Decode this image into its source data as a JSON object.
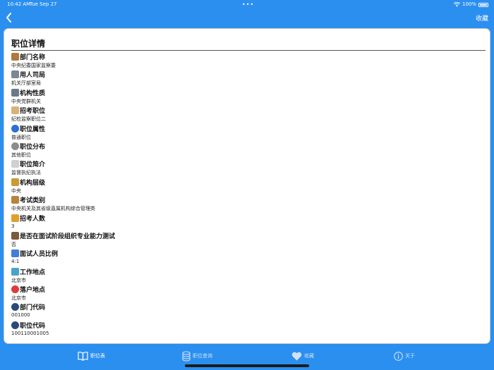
{
  "status": {
    "time": "10:42 AM",
    "date": "Tue Sep 27",
    "battery": "100%"
  },
  "nav": {
    "favorite_label": "收藏"
  },
  "page": {
    "title": "职位详情"
  },
  "fields": [
    {
      "label": "部门名称",
      "value": "中央纪委国家监察委",
      "icon": "classical-building-icon",
      "color": "#b07a3c"
    },
    {
      "label": "用人司局",
      "value": "机关厅部室局",
      "icon": "office-building-icon",
      "color": "#7a8794"
    },
    {
      "label": "机构性质",
      "value": "中央党群机关",
      "icon": "office-building-icon",
      "color": "#6b7a89"
    },
    {
      "label": "招考职位",
      "value": "纪检监察职位二",
      "icon": "id-card-icon",
      "color": "#d9b27a"
    },
    {
      "label": "职位属性",
      "value": "普通职位",
      "icon": "blue-circle-icon",
      "color": "#2d6fd6"
    },
    {
      "label": "职位分布",
      "value": "其他职位",
      "icon": "disk-icon",
      "color": "#8c8c8c"
    },
    {
      "label": "职位简介",
      "value": "监督执纪执法",
      "icon": "document-icon",
      "color": "#d0d0d0"
    },
    {
      "label": "机构层级",
      "value": "中央",
      "icon": "people-tree-icon",
      "color": "#c79b36"
    },
    {
      "label": "考试类别",
      "value": "中央机关及其省级直属机构综合管理类",
      "icon": "books-icon",
      "color": "#b8833f"
    },
    {
      "label": "招考人数",
      "value": "3",
      "icon": "people-icon",
      "color": "#e0a030"
    },
    {
      "label": "是否在面试阶段组织专业能力测试",
      "value": "否",
      "icon": "detective-icon",
      "color": "#7a5a3a"
    },
    {
      "label": "面试人员比例",
      "value": "4:1",
      "icon": "bar-chart-icon",
      "color": "#3f7fd9"
    },
    {
      "label": "工作地点",
      "value": "北京市",
      "icon": "world-map-icon",
      "color": "#4aa3c8"
    },
    {
      "label": "落户地点",
      "value": "北京市",
      "icon": "round-pin-icon",
      "color": "#e03a3a"
    },
    {
      "label": "部门代码",
      "value": "001000",
      "icon": "globe-icon",
      "color": "#2b4a7a"
    },
    {
      "label": "职位代码",
      "value": "100110001005",
      "icon": "globe-icon",
      "color": "#2b4a7a"
    }
  ],
  "tabs": [
    {
      "label": "职位表",
      "icon": "book-icon",
      "active": true
    },
    {
      "label": "职位查询",
      "icon": "database-icon",
      "active": false
    },
    {
      "label": "收藏",
      "icon": "heart-icon",
      "active": false
    },
    {
      "label": "关于",
      "icon": "info-icon",
      "active": false
    }
  ],
  "colors": {
    "accent": "#2b8ff0",
    "card": "#ffffff"
  }
}
